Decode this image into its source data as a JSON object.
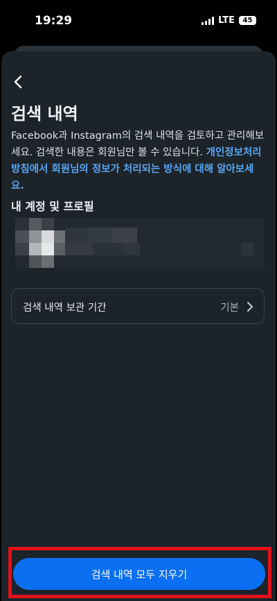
{
  "status": {
    "time": "19:29",
    "network": "LTE",
    "battery": "45"
  },
  "page": {
    "title": "검색 내역",
    "description_plain": "Facebook과 Instagram의 검색 내역을 검토하고 관리해보세요. 검색한 내용은 회원님만 볼 수 있습니다. ",
    "description_link": "개인정보처리방침에서 회원님의 정보가 처리되는 방식에 대해 알아보세요."
  },
  "section": {
    "title": "내 계정 및 프로필"
  },
  "retention": {
    "label": "검색 내역 보관 기간",
    "value": "기본"
  },
  "actions": {
    "clear_all": "검색 내역 모두 지우기"
  },
  "icons": {
    "back": "back-chevron-icon",
    "chevron": "chevron-right-icon"
  },
  "colors": {
    "accent": "#0a6ff0",
    "link": "#58a6f0",
    "highlight": "#e3101a",
    "sheet": "#1c2329"
  }
}
